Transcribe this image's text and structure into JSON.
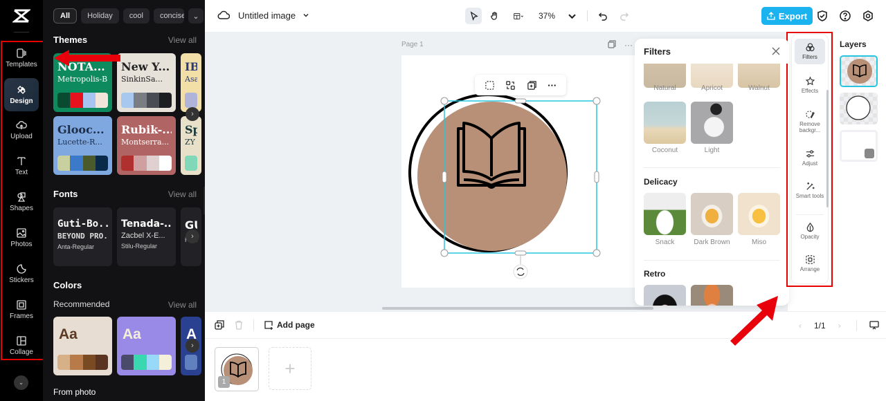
{
  "rail": {
    "items": [
      {
        "label": "Templates",
        "icon": "templates-icon"
      },
      {
        "label": "Design",
        "icon": "design-icon",
        "active": true
      },
      {
        "label": "Upload",
        "icon": "upload-icon"
      },
      {
        "label": "Text",
        "icon": "text-icon"
      },
      {
        "label": "Shapes",
        "icon": "shapes-icon"
      },
      {
        "label": "Photos",
        "icon": "photos-icon"
      },
      {
        "label": "Stickers",
        "icon": "stickers-icon"
      },
      {
        "label": "Frames",
        "icon": "frames-icon"
      },
      {
        "label": "Collage",
        "icon": "collage-icon"
      }
    ],
    "more": "⌄"
  },
  "panel": {
    "chips": [
      "All",
      "Holiday",
      "cool",
      "concise"
    ],
    "chip_more": "⌄",
    "themes": {
      "title": "Themes",
      "view_all": "View all",
      "cards": [
        {
          "t1": "NOTA...",
          "t2": "Metropolis-B...",
          "bg": "#0e8a5f",
          "fg": "#ffffff",
          "colors": [
            "#0a4a30",
            "#e8121f",
            "#a8c4f0",
            "#f2e4d8"
          ]
        },
        {
          "t1": "New Y...",
          "t2": "SinkinSa...",
          "bg": "#e6e1d9",
          "fg": "#222222",
          "colors": [
            "#a8c8f0",
            "#7a7e82",
            "#4a4e54",
            "#1c1e22"
          ]
        },
        {
          "t1": "IB",
          "t2": "Asa",
          "bg": "#f2dfa8",
          "fg": "#2a3a7a",
          "colors": [
            "#b0b4d8"
          ]
        },
        {
          "t1": "Glooc...",
          "t2": "Lucette-R...",
          "bg": "#7fa8e0",
          "fg": "#1c2e4a",
          "colors": [
            "#c8d0a0",
            "#3a7ac8",
            "#4a5a2a",
            "#0a2a4a"
          ]
        },
        {
          "t1": "Rubik-...",
          "t2": "Montserra...",
          "bg": "#b06464",
          "fg": "#ffffff",
          "colors": [
            "#b03030",
            "#d0a0a0",
            "#e0d0d0",
            "#ffffff"
          ]
        },
        {
          "t1": "Sp",
          "t2": "ZY",
          "bg": "#e8e0c8",
          "fg": "#1a3a3a",
          "colors": [
            "#80d8b8"
          ]
        }
      ]
    },
    "fonts": {
      "title": "Fonts",
      "view_all": "View all",
      "cards": [
        {
          "f1": "Guti-Bo...",
          "f2": "BEYOND PRO...",
          "f3": "Anta-Regular"
        },
        {
          "f1": "Tenada-...",
          "f2": "Zacbel X-E...",
          "f3": "Stilu-Regular"
        },
        {
          "f1": "GU",
          "f2": "",
          "f3": "Ham"
        }
      ]
    },
    "colors": {
      "title": "Colors",
      "recommended": "Recommended",
      "view_all": "View all",
      "cards": [
        {
          "aa": "Aa",
          "bg": "#e8ddd2",
          "fg": "#5a3a22",
          "colors": [
            "#d8b088",
            "#b87a48",
            "#7a4a22",
            "#5a3420"
          ]
        },
        {
          "aa": "Aa",
          "bg": "#9a8ae8",
          "fg": "#f4efd8",
          "colors": [
            "#4a4a6a",
            "#3ad8b0",
            "#98d8f8",
            "#f4efd8"
          ]
        },
        {
          "aa": "A",
          "bg": "#2a4090",
          "fg": "#ffffff",
          "colors": [
            "#6080c0"
          ]
        }
      ],
      "from_photo": "From photo"
    }
  },
  "topbar": {
    "doc_title": "Untitled image",
    "zoom": "37%",
    "export_label": "Export",
    "accent": "#1ab3f0"
  },
  "canvas": {
    "page_label": "Page 1",
    "circle_color": "#b89078"
  },
  "filters": {
    "title": "Filters",
    "row1": [
      {
        "label": "Natural"
      },
      {
        "label": "Apricot"
      },
      {
        "label": "Walnut"
      }
    ],
    "row2": [
      {
        "label": "Coconut"
      },
      {
        "label": "Light"
      }
    ],
    "delicacy": {
      "title": "Delicacy",
      "items": [
        {
          "label": "Snack"
        },
        {
          "label": "Dark Brown"
        },
        {
          "label": "Miso"
        }
      ]
    },
    "retro": {
      "title": "Retro"
    }
  },
  "props": [
    {
      "label": "Filters",
      "icon": "filters-icon",
      "active": true
    },
    {
      "label": "Effects",
      "icon": "effects-icon"
    },
    {
      "label": "Remove backgr...",
      "icon": "remove-background-icon"
    },
    {
      "label": "Adjust",
      "icon": "adjust-icon"
    },
    {
      "label": "Smart tools",
      "icon": "smart-tools-icon"
    },
    {
      "label": "Opacity",
      "icon": "opacity-icon"
    },
    {
      "label": "Arrange",
      "icon": "arrange-icon"
    }
  ],
  "layers": {
    "title": "Layers"
  },
  "bottom": {
    "add_page": "Add page",
    "pager": "1/1",
    "page_number": "1",
    "add_thumb": "+"
  }
}
